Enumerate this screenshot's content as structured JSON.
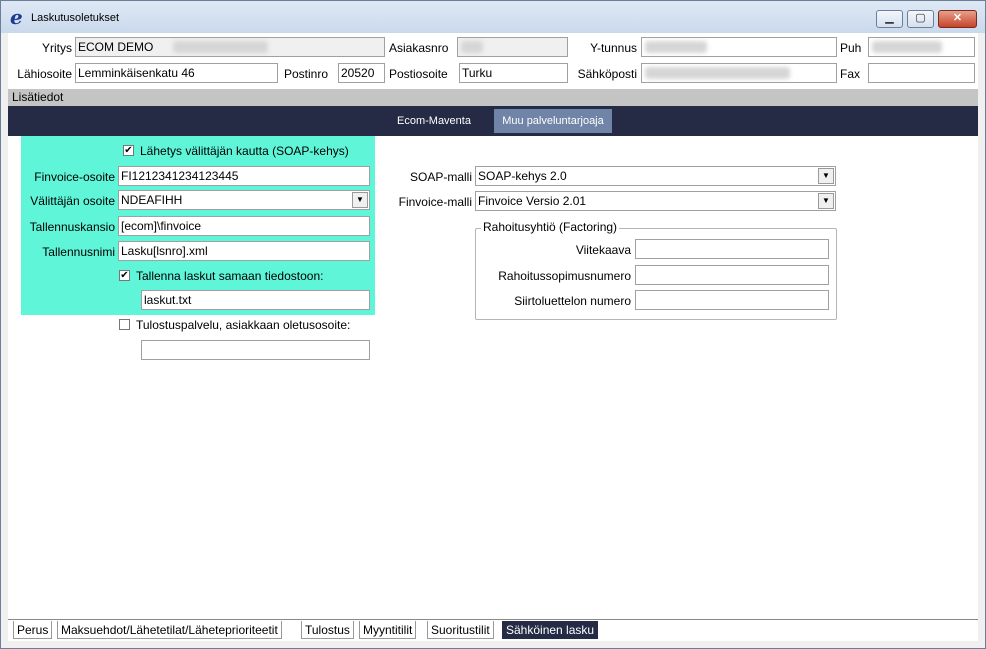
{
  "window": {
    "title": "Laskutusoletukset",
    "icon": "e-logo-icon"
  },
  "header": {
    "yritys_label": "Yritys",
    "yritys_value": "ECOM DEMO",
    "asiakasnro_label": "Asiakasnro",
    "ytunnus_label": "Y-tunnus",
    "puh_label": "Puh",
    "lahiosoite_label": "Lähiosoite",
    "lahiosoite_value": "Lemminkäisenkatu 46",
    "postinro_label": "Postinro",
    "postinro_value": "20520",
    "postiosoite_label": "Postiosoite",
    "postiosoite_value": "Turku",
    "sahkoposti_label": "Sähköposti",
    "fax_label": "Fax"
  },
  "section": {
    "title": "Lisätiedot"
  },
  "tabs": [
    {
      "label": "Ecom-Maventa"
    },
    {
      "label": "Muu palveluntarjoaja"
    }
  ],
  "form": {
    "soap_checkbox_label": "Lähetys välittäjän kautta (SOAP-kehys)",
    "finvoice_osoite_label": "Finvoice-osoite",
    "finvoice_osoite_value": "FI1212341234123445",
    "valittajan_osoite_label": "Välittäjän osoite",
    "valittajan_osoite_value": "NDEAFIHH",
    "tallennuskansio_label": "Tallennuskansio",
    "tallennuskansio_value": "[ecom]\\finvoice",
    "tallennusnimi_label": "Tallennusnimi",
    "tallennusnimi_value": "Lasku[lsnro].xml",
    "samaan_checkbox_label": "Tallenna laskut samaan tiedostoon:",
    "samaan_value": "laskut.txt",
    "tulostus_checkbox_label": "Tulostuspalvelu, asiakkaan oletusosoite:",
    "tulostus_value": ""
  },
  "right": {
    "soap_malli_label": "SOAP-malli",
    "soap_malli_value": "SOAP-kehys 2.0",
    "finvoice_malli_label": "Finvoice-malli",
    "finvoice_malli_value": "Finvoice Versio 2.01",
    "group_title": "Rahoitusyhtiö (Factoring)",
    "viitekaava_label": "Viitekaava",
    "rahoitussopimus_label": "Rahoitussopimusnumero",
    "siirtoluettelo_label": "Siirtoluettelon numero"
  },
  "bottom_tabs": [
    {
      "label": "Perus"
    },
    {
      "label": "Maksuehdot/Lähetetilat/Läheteprioriteetit"
    },
    {
      "label": "Tulostus"
    },
    {
      "label": "Myyntitilit"
    },
    {
      "label": "Suoritustilit"
    },
    {
      "label": "Sähköinen lasku"
    }
  ]
}
